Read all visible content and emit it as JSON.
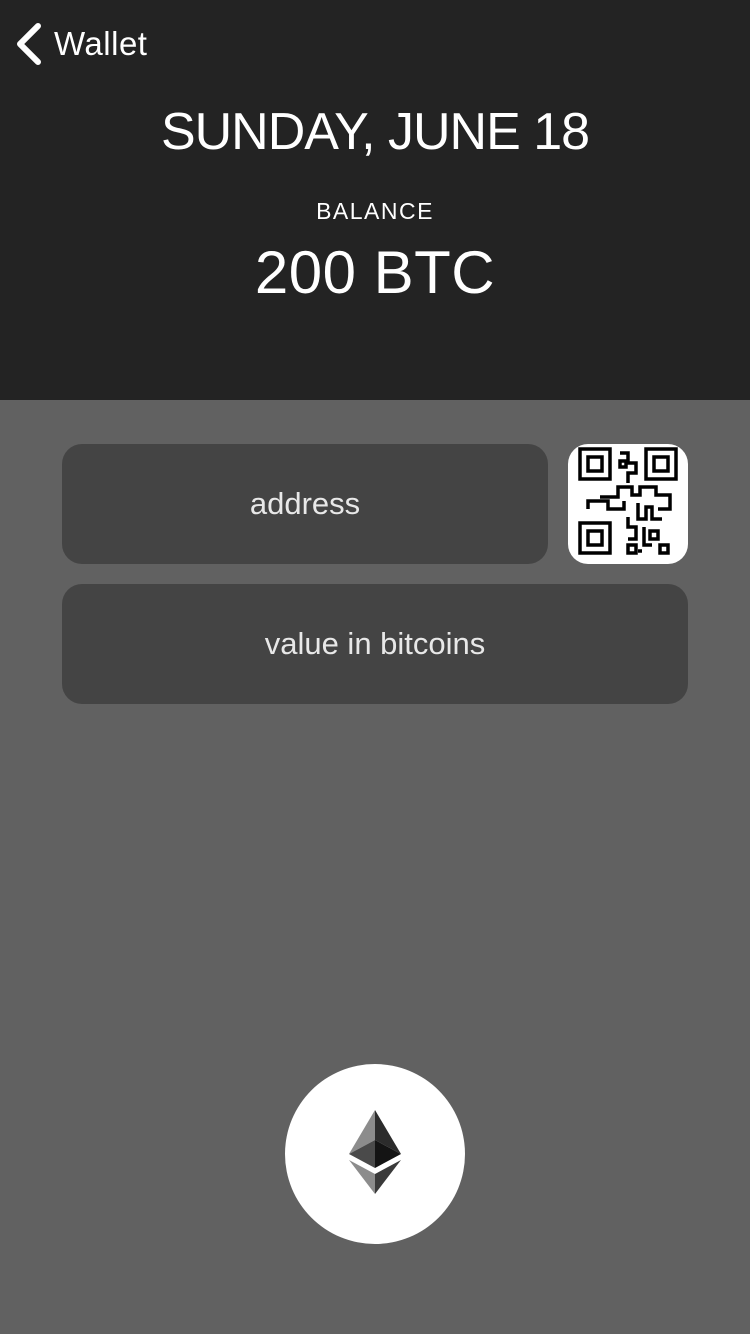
{
  "nav": {
    "back_label": "Wallet",
    "back_icon": "chevron-left-icon"
  },
  "header": {
    "date": "SUNDAY, JUNE 18",
    "balance_label": "BALANCE",
    "balance_value": "200 BTC"
  },
  "form": {
    "address_placeholder": "address",
    "value_placeholder": "value in bitcoins",
    "qr_icon": "qr-code-icon"
  },
  "send": {
    "icon": "ethereum-icon"
  },
  "colors": {
    "header_bg": "#232323",
    "body_bg": "#616161",
    "field_bg": "#444444",
    "text": "#ffffff"
  }
}
